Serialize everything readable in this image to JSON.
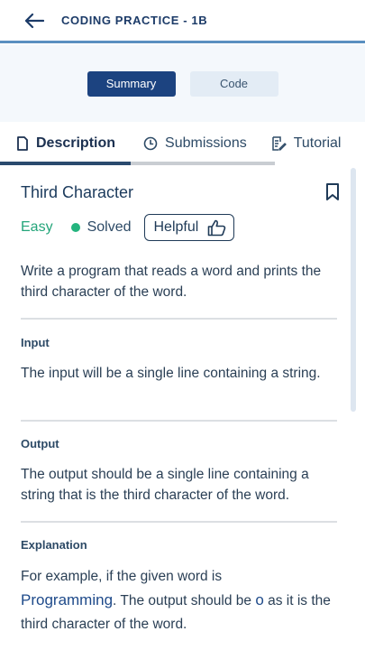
{
  "header": {
    "title": "CODING PRACTICE - 1B",
    "back_icon": "arrow-left-icon"
  },
  "toggle": {
    "summary": "Summary",
    "code": "Code"
  },
  "tabs": [
    {
      "label": "Description",
      "icon": "document-icon",
      "active": true
    },
    {
      "label": "Submissions",
      "icon": "clock-icon",
      "active": false
    },
    {
      "label": "Tutorial",
      "icon": "edit-note-icon",
      "active": false
    }
  ],
  "problem": {
    "title": "Third Character",
    "difficulty": "Easy",
    "status": "Solved",
    "helpful": "Helpful",
    "statement": "Write a program that reads a word and prints the third character of the word."
  },
  "input": {
    "heading": "Input",
    "text": "The input will be a single line containing a string."
  },
  "output": {
    "heading": "Output",
    "text": "The output should be a single line containing a string that is the third character of the word."
  },
  "explanation": {
    "heading": "Explanation",
    "pre": "For example, if the given word is",
    "word": "Programming",
    "mid": ". The output should be ",
    "char": "o",
    "post": " as it is the third character of the word."
  },
  "colors": {
    "accent": "#1c4380",
    "easy": "#24a57a",
    "solved": "#24b47e"
  }
}
